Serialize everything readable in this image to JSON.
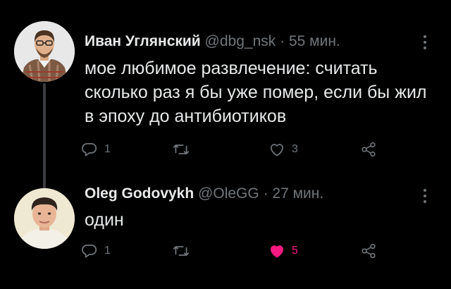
{
  "tweets": [
    {
      "author_name": "Иван Углянский",
      "handle": "@dbg_nsk",
      "time": "55 мин.",
      "text": "мое любимое развлечение: считать сколько раз я бы уже помер, если бы жил в эпоху до антибиотиков",
      "reply_count": "1",
      "retweet_count": "",
      "like_count": "3",
      "liked": false
    },
    {
      "author_name": "Oleg Godovykh",
      "handle": "@OleGG",
      "time": "27 мин.",
      "text": "один",
      "reply_count": "1",
      "retweet_count": "",
      "like_count": "5",
      "liked": true
    }
  ],
  "separator": "·",
  "colors": {
    "background": "#000000",
    "text": "#e7e9ea",
    "muted": "#71767b",
    "like": "#f91880"
  },
  "icons": [
    "reply-icon",
    "retweet-icon",
    "like-icon",
    "share-icon",
    "more-icon"
  ]
}
